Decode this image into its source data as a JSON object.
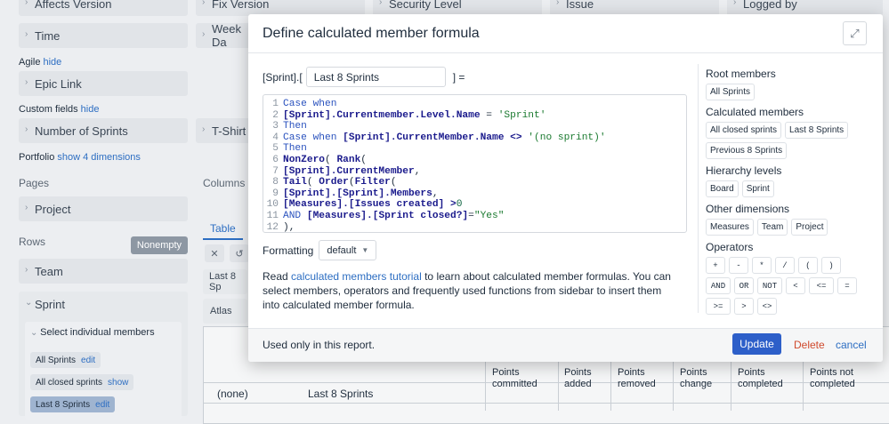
{
  "background": {
    "dimensions_top": [
      {
        "label": "Affects Version"
      },
      {
        "label": "Fix Version"
      },
      {
        "label": "Security Level"
      },
      {
        "label": "Issue"
      },
      {
        "label": "Logged by"
      }
    ],
    "time_dims": [
      {
        "label": "Time"
      },
      {
        "label": "Week Da"
      }
    ],
    "agile_label": "Agile",
    "agile_hide": "hide",
    "epic_link": "Epic Link",
    "custom_label": "Custom fields",
    "custom_hide": "hide",
    "number_of_sprints": "Number of Sprints",
    "tshirt": "T-Shirt S",
    "portfolio_label": "Portfolio",
    "portfolio_show": "show 4 dimensions",
    "pages_label": "Pages",
    "columns_label": "Columns",
    "project": "Project",
    "rows_label": "Rows",
    "nonempty": "Nonempty",
    "table_tab": "Table",
    "team": "Team",
    "sprint": "Sprint",
    "select_individual": "Select individual members",
    "members": [
      {
        "label": "All Sprints",
        "link": "edit"
      },
      {
        "label": "All closed sprints",
        "link": "show"
      },
      {
        "label": "Last 8 Sprints",
        "link": "edit"
      }
    ],
    "crumb1": "Last 8 Sp",
    "atlas": "Atlas",
    "table": {
      "headers": [
        "Points committed",
        "Points added",
        "Points removed",
        "Points change",
        "Points completed",
        "Points not completed"
      ],
      "row_label": "(none)",
      "row_value": "Last 8 Sprints"
    }
  },
  "modal": {
    "title": "Define calculated member formula",
    "name_prefix": "[Sprint].[",
    "name_value": "Last 8 Sprints",
    "name_suffix": "] =",
    "formatting_label": "Formatting",
    "formatting_value": "default",
    "help_pre": "Read ",
    "help_link": "calculated members tutorial",
    "help_post": " to learn about calculated member formulas. You can select members, operators and frequently used functions from sidebar to insert them into calculated member formula.",
    "footer_note": "Used only in this report.",
    "update": "Update",
    "delete": "Delete",
    "cancel": "cancel",
    "code_lines": [
      "1",
      "2",
      "3",
      "4",
      "5",
      "6",
      "7",
      "8",
      "9",
      "10",
      "11",
      "12"
    ],
    "code": {
      "l1_case": "Case",
      "l1_when": "when",
      "l2": "[Sprint].Currentmember.Level.Name",
      "l2_op": " = ",
      "l2_str": "'Sprint'",
      "l3": "Then",
      "l4_case": "Case",
      "l4_when": "when",
      "l4_mem": "[Sprint].CurrentMember.Name",
      "l4_op": " <> ",
      "l4_str": "'(no sprint)'",
      "l5": "Then",
      "l6_fn": "NonZero",
      "l6_rest": "( ",
      "l6_fn2": "Rank",
      "l6_paren": "(",
      "l7": "[Sprint].CurrentMember",
      "l7_c": ",",
      "l8_fn": "Tail",
      "l8_a": "( ",
      "l8_fn2": "Order",
      "l8_b": "(",
      "l8_fn3": "Filter",
      "l8_c": "(",
      "l9": "[Sprint].[Sprint].Members",
      "l9_c": ",",
      "l10": "[Measures].[Issues created]",
      "l10_op": " >",
      "l10_num": "0",
      "l11_and": "AND",
      "l11_mem": "[Measures].[Sprint closed?]",
      "l11_op": "=",
      "l11_str": "\"Yes\"",
      "l12": "),"
    },
    "sidebar": {
      "root_title": "Root members",
      "root": [
        "All Sprints"
      ],
      "calc_title": "Calculated members",
      "calc": [
        "All closed sprints",
        "Last 8 Sprints",
        "Previous 8 Sprints"
      ],
      "hier_title": "Hierarchy levels",
      "hier": [
        "Board",
        "Sprint"
      ],
      "other_title": "Other dimensions",
      "other": [
        "Measures",
        "Team",
        "Project"
      ],
      "ops_title": "Operators",
      "ops": [
        "+",
        "-",
        "*",
        "/",
        "(",
        ")",
        "AND",
        "OR",
        "NOT",
        "<",
        "<=",
        "=",
        ">=",
        ">",
        "<>"
      ]
    }
  }
}
